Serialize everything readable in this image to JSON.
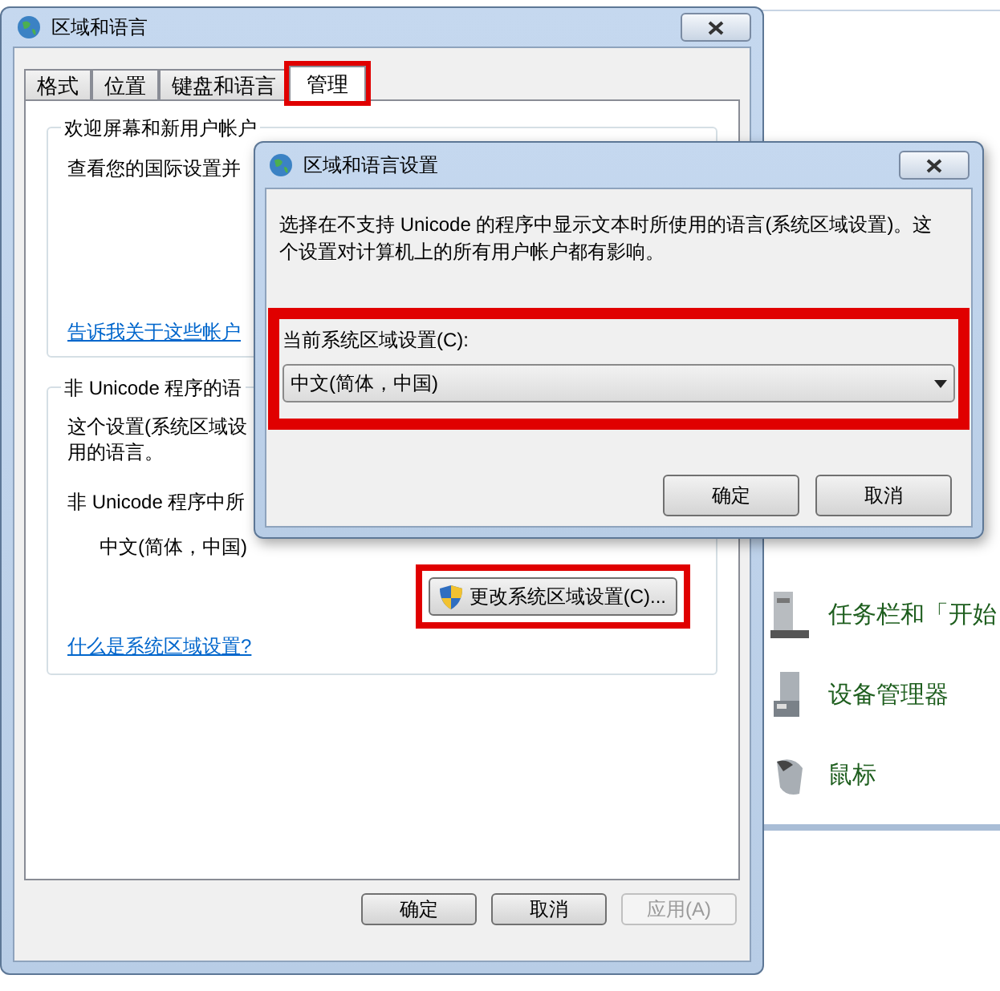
{
  "background_window": {
    "items": [
      {
        "kind": "taskbar",
        "label": "任务栏和「开始"
      },
      {
        "kind": "device",
        "label": "设备管理器"
      },
      {
        "kind": "mouse",
        "label": "鼠标"
      }
    ]
  },
  "window": {
    "title": "区域和语言",
    "tabs": [
      {
        "label": "格式",
        "selected": false,
        "highlighted": false
      },
      {
        "label": "位置",
        "selected": false,
        "highlighted": false
      },
      {
        "label": "键盘和语言",
        "selected": false,
        "highlighted": false
      },
      {
        "label": "管理",
        "selected": true,
        "highlighted": true
      }
    ],
    "welcome_group": {
      "legend": "欢迎屏幕和新用户帐户",
      "text": "查看您的国际设置并",
      "link": "告诉我关于这些帐户"
    },
    "non_unicode_group": {
      "legend": "非 Unicode 程序的语",
      "lines": [
        "这个设置(系统区域设",
        "用的语言。"
      ],
      "current_label": "非 Unicode 程序中所",
      "current_value": "中文(简体，中国)",
      "change_button": {
        "label": "更改系统区域设置(C)...",
        "highlighted": true
      },
      "link": "什么是系统区域设置?"
    },
    "buttons": [
      {
        "label": "确定",
        "disabled": false
      },
      {
        "label": "取消",
        "disabled": false
      },
      {
        "label": "应用(A)",
        "disabled": true
      }
    ]
  },
  "dialog": {
    "title": "区域和语言设置",
    "description": "选择在不支持 Unicode 的程序中显示文本时所使用的语言(系统区域设置)。这个设置对计算机上的所有用户帐户都有影响。",
    "locale_label": "当前系统区域设置(C):",
    "locale_value": "中文(简体，中国)",
    "highlighted": true,
    "buttons": [
      "确定",
      "取消"
    ]
  }
}
